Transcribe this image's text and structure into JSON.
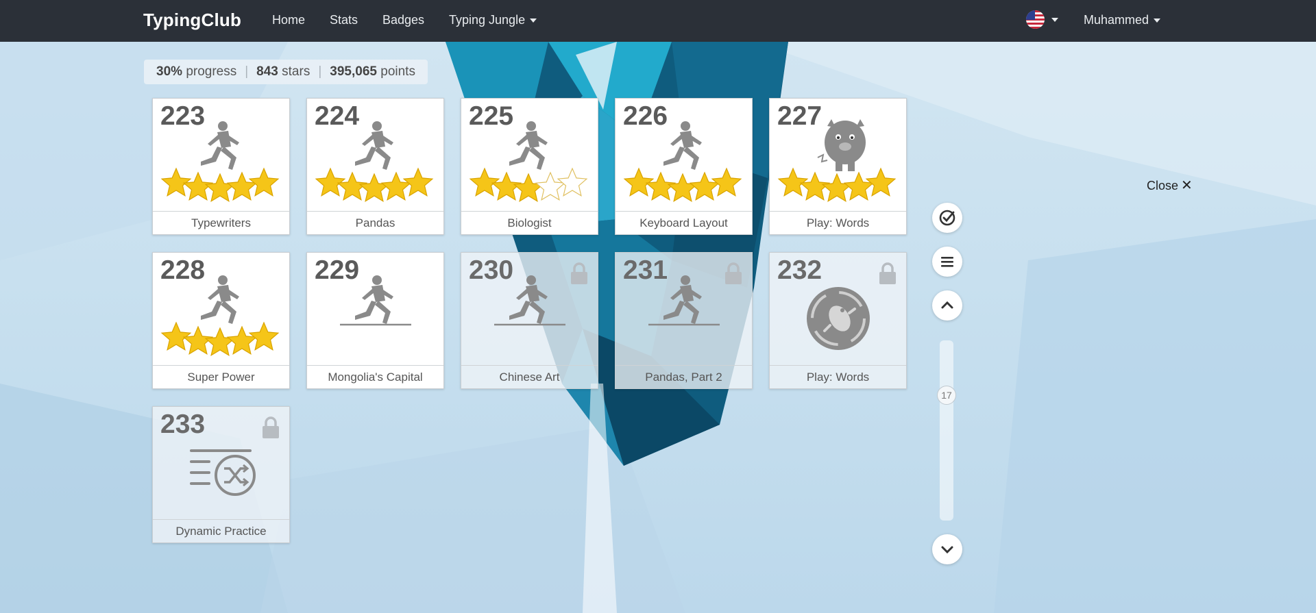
{
  "navbar": {
    "brand": "TypingClub",
    "links": [
      "Home",
      "Stats",
      "Badges"
    ],
    "dropdown": "Typing Jungle",
    "user": "Muhammed",
    "flag_icon": "us-flag-icon"
  },
  "progress": {
    "percent": "30%",
    "percent_label": "progress",
    "stars": "843",
    "stars_label": "stars",
    "points": "395,065",
    "points_label": "points"
  },
  "close_label": "Close",
  "scroll_position_label": "17",
  "colors": {
    "navbar": "#2b3038",
    "star": "#f5c518",
    "icon_gray": "#8a8a8a"
  },
  "lessons": [
    {
      "number": "223",
      "title": "Typewriters",
      "icon": "runner-icon",
      "stars": 5,
      "locked": false
    },
    {
      "number": "224",
      "title": "Pandas",
      "icon": "runner-icon",
      "stars": 5,
      "locked": false
    },
    {
      "number": "225",
      "title": "Biologist",
      "icon": "runner-icon",
      "stars": 3,
      "locked": false
    },
    {
      "number": "226",
      "title": "Keyboard Layout",
      "icon": "runner-icon",
      "stars": 5,
      "locked": false
    },
    {
      "number": "227",
      "title": "Play: Words",
      "icon": "monster-icon",
      "stars": 5,
      "locked": false
    },
    {
      "number": "228",
      "title": "Super Power",
      "icon": "runner-icon",
      "stars": 5,
      "locked": false
    },
    {
      "number": "229",
      "title": "Mongolia's Capital",
      "icon": "runner-icon",
      "stars": 0,
      "locked": false
    },
    {
      "number": "230",
      "title": "Chinese Art",
      "icon": "runner-icon",
      "stars": 0,
      "locked": true
    },
    {
      "number": "231",
      "title": "Pandas, Part 2",
      "icon": "runner-icon",
      "stars": 0,
      "locked": true
    },
    {
      "number": "232",
      "title": "Play: Words",
      "icon": "game-badge-icon",
      "stars": 0,
      "locked": true
    },
    {
      "number": "233",
      "title": "Dynamic Practice",
      "icon": "shuffle-list-icon",
      "stars": 0,
      "locked": true
    }
  ]
}
